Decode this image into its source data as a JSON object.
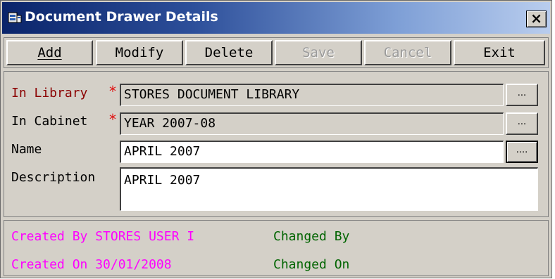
{
  "window": {
    "title": "Document Drawer Details",
    "close_label": "×"
  },
  "toolbar": {
    "buttons": [
      {
        "label": "Add",
        "enabled": true
      },
      {
        "label": "Modify",
        "enabled": true
      },
      {
        "label": "Delete",
        "enabled": true
      },
      {
        "label": "Save",
        "enabled": false
      },
      {
        "label": "Cancel",
        "enabled": false
      },
      {
        "label": "Exit",
        "enabled": true
      }
    ]
  },
  "form": {
    "library": {
      "label": "In Library",
      "required_mark": "*",
      "value": "STORES DOCUMENT LIBRARY",
      "browse_label": "..."
    },
    "cabinet": {
      "label": "In Cabinet",
      "required_mark": "*",
      "value": "YEAR 2007-08",
      "browse_label": "..."
    },
    "name": {
      "label": "Name",
      "value": "APRIL 2007",
      "browse_label": "...."
    },
    "description": {
      "label": "Description",
      "value": "APRIL 2007"
    }
  },
  "status": {
    "created_by": "Created By STORES USER I",
    "created_on": "Created On 30/01/2008",
    "changed_by": "Changed By",
    "changed_on": "Changed On"
  },
  "colors": {
    "title_gradient_start": "#0a246a",
    "title_gradient_end": "#b9cdee",
    "window_bg": "#d4d0c8",
    "required_label": "#8b0000",
    "required_mark": "#e01010",
    "created_text": "#ff00ff",
    "changed_text": "#006400"
  }
}
